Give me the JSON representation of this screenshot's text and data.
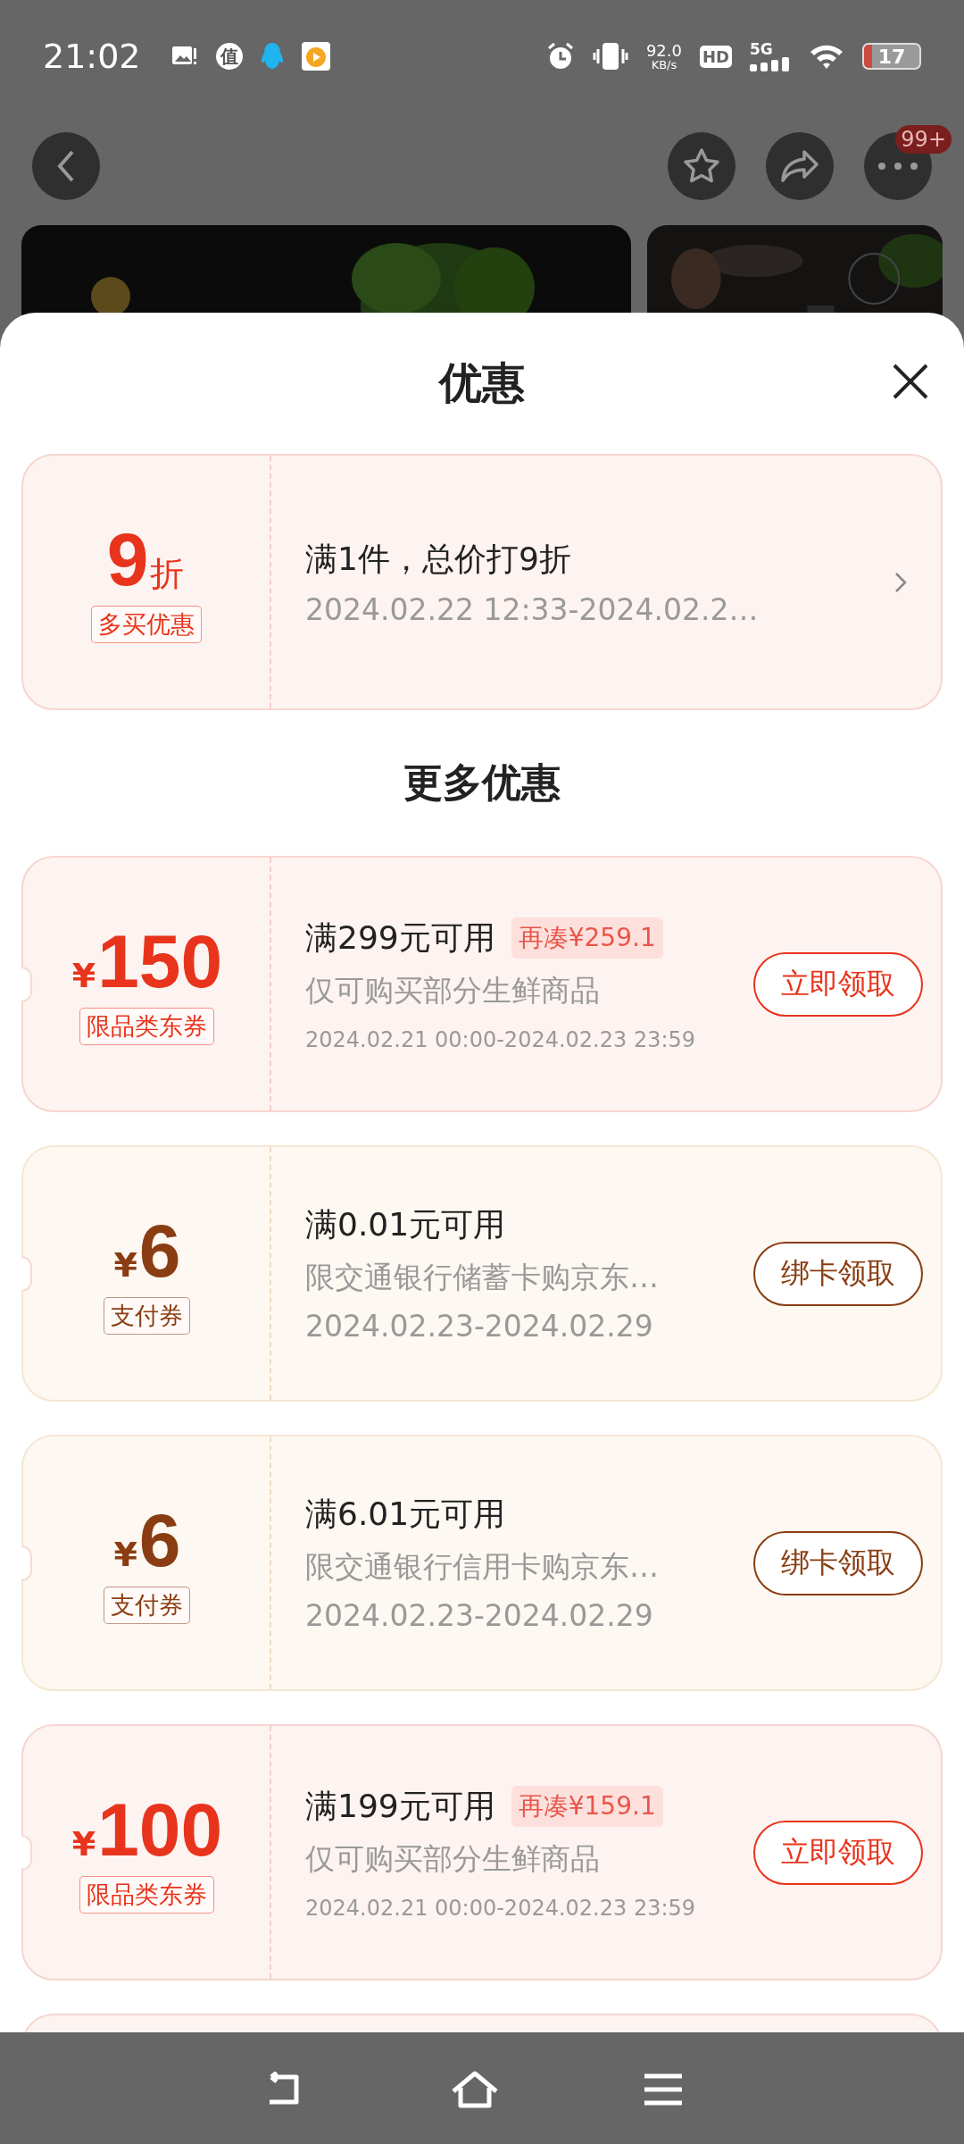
{
  "status_bar": {
    "time": "21:02",
    "app_badge": "值",
    "net_speed": "92.0",
    "net_unit": "KB/s",
    "hd": "HD",
    "network": "5G",
    "battery": "17"
  },
  "top_nav": {
    "more_badge": "99+"
  },
  "sheet": {
    "title": "优惠",
    "section_title": "更多优惠"
  },
  "discount": {
    "value": "9",
    "unit": "折",
    "tag": "多买优惠",
    "title": "满1件，总价打9折",
    "period": "2024.02.22 12:33-2024.02.2…",
    "color": "#e8341c"
  },
  "coupons": [
    {
      "currency": "¥",
      "amount": "150",
      "tag": "限品类东券",
      "title": "满299元可用",
      "gap_tag": "再凑¥259.1",
      "desc": "仅可购买部分生鲜商品",
      "period": "2024.02.21 00:00-2024.02.23 23:59",
      "kind": "category",
      "button": "立即领取",
      "color": "#e8341c"
    },
    {
      "currency": "¥",
      "amount": "6",
      "tag": "支付券",
      "title": "满0.01元可用",
      "desc": "限交通银行储蓄卡购京东…",
      "period": "2024.02.23-2024.02.29",
      "kind": "payment",
      "button": "绑卡领取",
      "color": "#8a3d12"
    },
    {
      "currency": "¥",
      "amount": "6",
      "tag": "支付券",
      "title": "满6.01元可用",
      "desc": "限交通银行信用卡购京东…",
      "period": "2024.02.23-2024.02.29",
      "kind": "payment",
      "button": "绑卡领取",
      "color": "#8a3d12"
    },
    {
      "currency": "¥",
      "amount": "100",
      "tag": "限品类东券",
      "title": "满199元可用",
      "gap_tag": "再凑¥159.1",
      "desc": "仅可购买部分生鲜商品",
      "period": "2024.02.21 00:00-2024.02.23 23:59",
      "kind": "category",
      "button": "立即领取",
      "color": "#e8341c"
    }
  ]
}
